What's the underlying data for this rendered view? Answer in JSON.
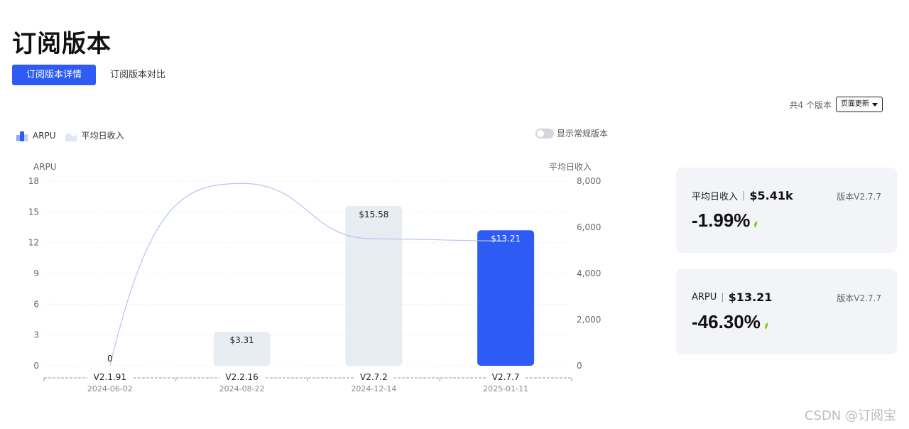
{
  "page": {
    "title": "订阅版本"
  },
  "tabs": [
    {
      "label": "订阅版本详情",
      "active": true
    },
    {
      "label": "订阅版本对比",
      "active": false
    }
  ],
  "toolbar": {
    "count_label": "共4 个版本",
    "update_label": "页面更新"
  },
  "legend": {
    "arpu": "ARPU",
    "revenue": "平均日收入"
  },
  "toggle": {
    "label": "显示常规版本",
    "on": false
  },
  "colors": {
    "accent": "#2f5bf5",
    "bar_muted": "#e8ecf3",
    "line": "#b6c6ee",
    "down_leaf": "#7ed321"
  },
  "chart_data": {
    "type": "bar",
    "title": "",
    "categories": [
      "V2.1.91",
      "V2.2.16",
      "V2.7.2",
      "V2.7.7"
    ],
    "dates": [
      "2024-06-02",
      "2024-08-22",
      "2024-12-14",
      "2025-01-11"
    ],
    "ylabel": "ARPU",
    "y2label": "平均日收入",
    "ylim": [
      0,
      18
    ],
    "yticks": [
      0,
      3,
      6,
      9,
      12,
      15,
      18
    ],
    "y2lim": [
      0,
      8000
    ],
    "y2ticks": [
      "0",
      "2,000",
      "4,000",
      "6,000",
      "8,000"
    ],
    "series": [
      {
        "name": "ARPU",
        "type": "bar",
        "values": [
          0,
          3.31,
          15.58,
          13.21
        ],
        "labels": [
          "0",
          "$3.31",
          "$15.58",
          "$13.21"
        ]
      },
      {
        "name": "平均日收入",
        "type": "line",
        "values": [
          0,
          7900,
          5500,
          5410
        ]
      }
    ],
    "highlight_index": 3,
    "grid": true
  },
  "cards": [
    {
      "metric": "平均日收入",
      "value": "$5.41k",
      "version": "版本V2.7.7",
      "change": "-1.99%"
    },
    {
      "metric": "ARPU",
      "value": "$13.21",
      "version": "版本V2.7.7",
      "change": "-46.30%"
    }
  ],
  "watermark": "CSDN @订阅宝"
}
